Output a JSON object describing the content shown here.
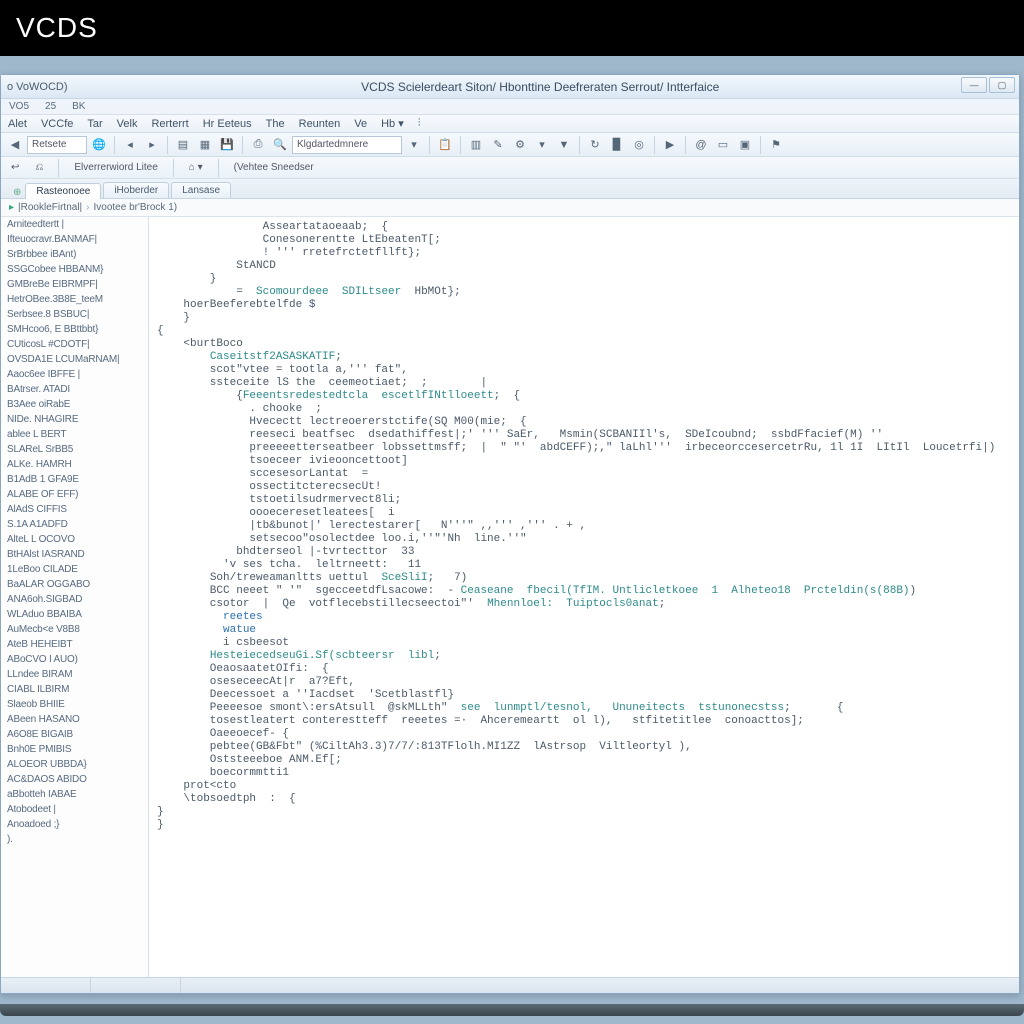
{
  "banner": {
    "logo": "VCDS"
  },
  "window": {
    "doc_label": "o VoWOCD)",
    "title": "VCDS Scielerdeart Siton/ Hbonttine Deefreraten Serrout/ Intterfaice",
    "subbar": [
      "VO5",
      "25",
      "BK"
    ],
    "menu": [
      "Alet",
      "VCCfe",
      "Tar",
      "Velk",
      "Rerterrt",
      "Hr Eeteus",
      "The",
      "Reunten",
      "Ve",
      "Hb ▾",
      "⫶"
    ],
    "toolbar_input": "Klgdartedmnere",
    "toolbar2": {
      "item1": "↩",
      "item2": "⎌",
      "item3": "Elverrerwiord  Litee",
      "item4": "⌂ ▾",
      "item5": "(Vehtee Sneedser"
    },
    "tabs": [
      "Rasteonoee",
      "iHoberder",
      "Lansase"
    ],
    "breadcrumb": [
      "|RookleFirtnal|",
      "Ivootee br'Brock  1)"
    ]
  },
  "sidebar": {
    "items": [
      "Arniteedtertt |",
      "Ifteuocravr.BANMAF|",
      "SrBrbbee iBAnt)",
      "SSGCobee HBBANM}",
      "GMBreBe EIBRMPF|",
      "HetrOBee.3B8E_teeM",
      "Serbsee.8 BSBUC|",
      "SMHcoo6, E BBttbbt}",
      "CUticosL  #CDOTF|",
      "OVSDA1E LCUMaRNAM|",
      "Aaoc6ee IBFFE  |",
      "BAtrser. ATADI",
      "B3Aee  oiRabE",
      "NIDe.  NHAGIRE",
      "ablee L BERT",
      "SLAReL  SrBB5",
      "ALKe.  HAMRH",
      "B1AdB  1 GFA9E",
      "ALABE  OF EFF)",
      "AlAdS  CIFFIS",
      "S.1A  A1ADFD",
      "AlteL  L OCOVO",
      "BtHAlst IASRAND",
      "1LeBoo  CILADE",
      "BaALAR  OGGABO",
      "ANA6oh.SIGBAD",
      "WLAduo BBAIBA",
      "AuMecb<e V8B8",
      "AteB  HEHEIBT",
      "ABoCVO I AUO)",
      "LLndee BIRAM",
      "CIABL ILBIRM",
      "Slaeob BHIIE",
      "ABeen HASANO",
      "A6O8E BIGAIB",
      "Bnh0E PMIBIS",
      "ALOEOR UBBDA}",
      "AC&DAOS ABIDO",
      "aBbotteh IABAE",
      "Atobodeet |",
      "Anoadoed ;}",
      ")."
    ]
  },
  "code": [
    {
      "i": 8,
      "t": "Asseartataoeaab;  {"
    },
    {
      "i": 8,
      "t": "Conesonerentte LtEbeatenT[;"
    },
    {
      "i": 8,
      "t": "! ''' rretefrctetfllft};"
    },
    {
      "i": 6,
      "t": "StANCD"
    },
    {
      "i": 4,
      "t": "}"
    },
    {
      "i": 6,
      "t": "=  ",
      "a": [
        {
          "c": "fn",
          "t": "Scomourdeee  SDILtseer"
        },
        {
          "c": "",
          "t": "  HbMOt};"
        }
      ]
    },
    {
      "i": 2,
      "t": "hoerBeeferebtelfde $"
    },
    {
      "i": 2,
      "t": "}"
    },
    {
      "i": 0,
      "t": "{"
    },
    {
      "i": 2,
      "t": "<burtBoco"
    },
    {
      "i": 4,
      "t": "",
      "a": [
        {
          "c": "fn",
          "t": "Caseitstf2ASASKATIF"
        },
        {
          "c": "",
          "t": ";"
        }
      ]
    },
    {
      "i": 4,
      "t": "scot\"vtee = tootla a,''' fat\", "
    },
    {
      "i": 4,
      "t": "ssteceite lS the  ceemeotiaet;  ;        |"
    },
    {
      "i": 6,
      "t": "{",
      "a": [
        {
          "c": "fn",
          "t": "Feeentsredestedtcla  escetlfINtlloeett"
        },
        {
          "c": "",
          "t": ";  {"
        }
      ]
    },
    {
      "i": 7,
      "t": ". chooke  ;"
    },
    {
      "i": 7,
      "t": "Hvecectt lectreoererstctife(SQ M00(mie;  {"
    },
    {
      "i": 7,
      "t": "reeseci beatfsec  dsedathiffest|;' ''' SaEr,   Msmin(SCBANIIl's,  SDeIcoubnd;  ssbdFfacief(M) ''"
    },
    {
      "i": 7,
      "t": "preeeeetterseatbeer lobssettmsff;  |  \" \"'  abdCEFF);,\" laLhl'''  irbeceorccesercetrRu, 1l 1I  LItIl  Loucetrfi|)"
    },
    {
      "i": 7,
      "t": "tsoeceer ivieooncettoot]"
    },
    {
      "i": 7,
      "t": "sccesesorLantat  ="
    },
    {
      "i": 7,
      "t": "ossectitcterecsecUt!"
    },
    {
      "i": 7,
      "t": "tstoetilsudrmervect8li;"
    },
    {
      "i": 7,
      "t": "oooeceresetleatees[  i"
    },
    {
      "i": 7,
      "t": "|tb&bunot|' lerectestarer[   N'''\" ,,''' ,''' . + ,"
    },
    {
      "i": 7,
      "t": "setsecoo\"osolectdee loo.i,''\"'Nh  line.''\""
    },
    {
      "i": 6,
      "t": "bhdterseol |-tvrtecttor  33"
    },
    {
      "i": 5,
      "t": "'v ses tcha.  leltrneett:   11"
    },
    {
      "i": 4,
      "t": "",
      "a": [
        {
          "c": "",
          "t": "Soh/treweamanltts uettul  "
        },
        {
          "c": "fn",
          "t": "SceSliI"
        },
        {
          "c": "",
          "t": ";   7)"
        }
      ]
    },
    {
      "i": 4,
      "t": "BCC neeet \" '\"  sgecceetdfLsacowe:  - ",
      "a": [
        {
          "c": "fn",
          "t": "Ceaseane  fbecil(TfIM. Untlicletkoee  1  Alheteo18  Prcteldin(s(88B)"
        },
        {
          "c": "",
          "t": ")"
        }
      ]
    },
    {
      "i": 4,
      "t": "csotor  |  Qe  votflecebstillecseectoi\"'  ",
      "a": [
        {
          "c": "fn",
          "t": "Mhennloel:  Tuiptocls0anat"
        },
        {
          "c": "",
          "t": ";"
        }
      ]
    },
    {
      "i": 5,
      "t": "",
      "a": [
        {
          "c": "kw",
          "t": "reetes"
        }
      ]
    },
    {
      "i": 5,
      "t": "",
      "a": [
        {
          "c": "kw",
          "t": "watue"
        }
      ]
    },
    {
      "i": 5,
      "t": "i csbeesot"
    },
    {
      "i": 4,
      "t": "",
      "a": [
        {
          "c": "fn",
          "t": "HesteiecedseuGi.Sf(scbteersr  libl"
        },
        {
          "c": "",
          "t": ";"
        }
      ]
    },
    {
      "i": 4,
      "t": "OeaosaatetOIfi:  {"
    },
    {
      "i": 4,
      "t": "oseseceecAt|r  a7?Eft,"
    },
    {
      "i": 4,
      "t": "Deecessoet a ''Iacdset  'Scetblastfl}"
    },
    {
      "i": 4,
      "t": "Peeeesoe smont\\:ersAtsull  @skMLLth\"  ",
      "a": [
        {
          "c": "fn",
          "t": "see  lunmptl/tesnol,   Ununeitects  tstunonecstss"
        },
        {
          "c": "",
          "t": ";       {"
        }
      ]
    },
    {
      "i": 4,
      "t": "tosestleatert conterestteff  reeetes =·  Ahceremeartt  ol l),   stfitetitlee  conoacttos];"
    },
    {
      "i": 4,
      "t": "Oaeeoecef- {"
    },
    {
      "i": 4,
      "t": "pebtee(GB&Fbt\" (%CiltAh3.3)7/7/:813TFlolh.MI1ZZ  lAstrsop  Viltleortyl ),"
    },
    {
      "i": 4,
      "t": "Oststeeeboe ANM.Ef[;"
    },
    {
      "i": 4,
      "t": "boecormmtti1"
    },
    {
      "i": 2,
      "t": "prot<cto"
    },
    {
      "i": 2,
      "t": "\\tobsoedtph  :  {"
    },
    {
      "i": 0,
      "t": "}"
    },
    {
      "i": 0,
      "t": ""
    },
    {
      "i": 0,
      "t": "}"
    }
  ]
}
